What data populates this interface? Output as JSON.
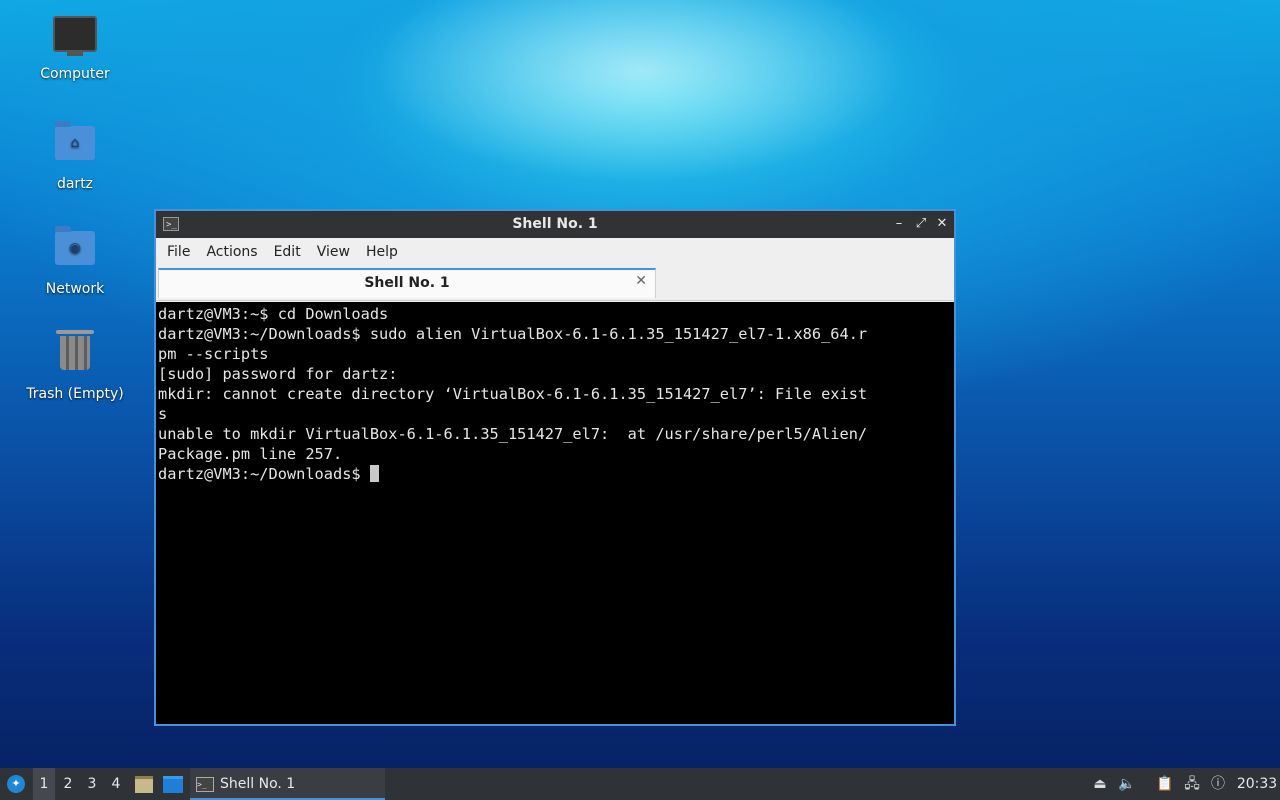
{
  "desktop": {
    "icons": [
      {
        "label": "Computer"
      },
      {
        "label": "dartz"
      },
      {
        "label": "Network"
      },
      {
        "label": "Trash (Empty)"
      }
    ]
  },
  "window": {
    "title": "Shell No. 1",
    "title_icon": "terminal-icon",
    "controls": {
      "minimize": "–",
      "maximize": "⤢",
      "close": "✕"
    },
    "menu": [
      "File",
      "Actions",
      "Edit",
      "View",
      "Help"
    ],
    "tab": {
      "label": "Shell No. 1",
      "close": "✕"
    },
    "terminal_lines": [
      "dartz@VM3:~$ cd Downloads",
      "dartz@VM3:~/Downloads$ sudo alien VirtualBox-6.1-6.1.35_151427_el7-1.x86_64.r",
      "pm --scripts",
      "[sudo] password for dartz:",
      "mkdir: cannot create directory ‘VirtualBox-6.1-6.1.35_151427_el7’: File exist",
      "s",
      "unable to mkdir VirtualBox-6.1-6.1.35_151427_el7:  at /usr/share/perl5/Alien/",
      "Package.pm line 257.",
      "dartz@VM3:~/Downloads$ "
    ]
  },
  "taskbar": {
    "workspaces": [
      "1",
      "2",
      "3",
      "4"
    ],
    "active_workspace": "1",
    "task": {
      "label": "Shell No. 1"
    },
    "tray_icons": [
      "eject-icon",
      "volume-icon",
      "clipboard-icon",
      "network-icon",
      "notification-icon"
    ],
    "clock": "20:33"
  },
  "colors": {
    "accent": "#4a90d9",
    "terminal_bg": "#000000",
    "titlebar_bg": "#303234",
    "taskbar_bg": "#2f3237"
  }
}
